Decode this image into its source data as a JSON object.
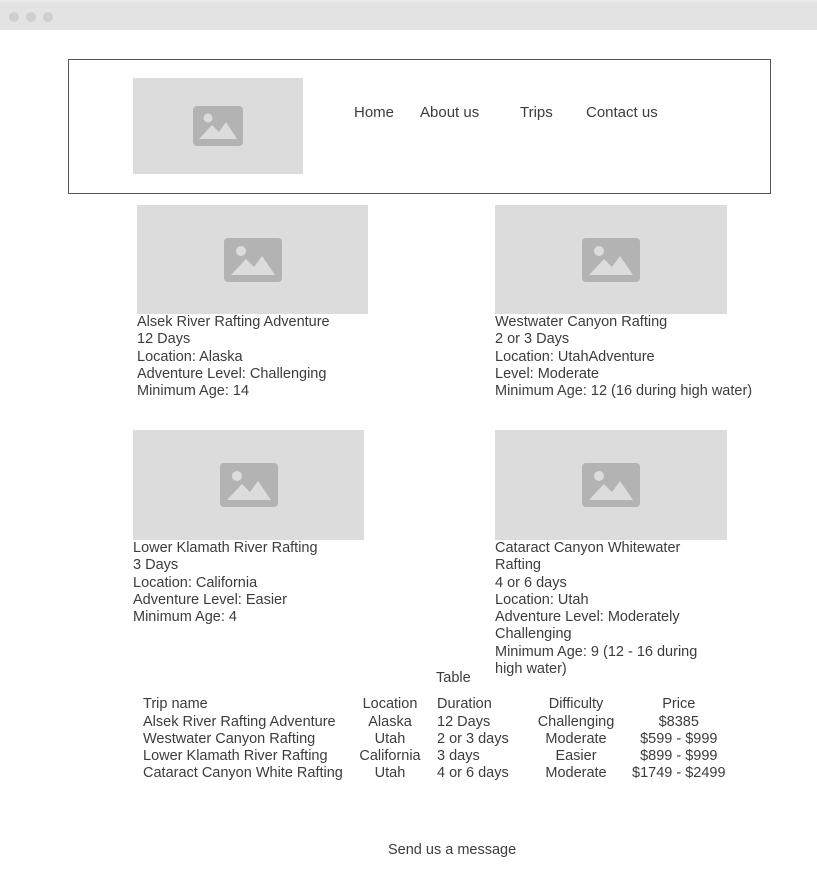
{
  "nav": {
    "items": [
      {
        "label": "Home"
      },
      {
        "label": "About us"
      },
      {
        "label": "Trips"
      },
      {
        "label": "Contact us"
      }
    ]
  },
  "cards": [
    {
      "title": "Alsek River Rafting Adventure",
      "duration": "12 Days",
      "location": "Location: Alaska",
      "level": "Adventure Level: Challenging",
      "age": "Minimum Age: 14"
    },
    {
      "title": "Westwater Canyon Rafting",
      "duration": "2 or 3 Days",
      "location": "Location: UtahAdventure",
      "level": "Level: Moderate",
      "age": "Minimum Age: 12 (16 during high water)"
    },
    {
      "title": "Lower Klamath River Rafting",
      "duration": "3 Days",
      "location": "Location: California",
      "level": "Adventure Level: Easier",
      "age": "Minimum Age: 4"
    },
    {
      "title": "Cataract Canyon Whitewater Rafting",
      "duration": "4 or 6 days",
      "location": "Location: Utah",
      "level": "Adventure Level: Moderately Challenging",
      "age": "Minimum Age: 9 (12 - 16 during high water)"
    }
  ],
  "table": {
    "title": "Table",
    "headers": [
      "Trip name",
      "Location",
      "Duration",
      "Difficulty",
      "Price"
    ],
    "rows": [
      [
        "Alsek River Rafting Adventure",
        "Alaska",
        "12 Days",
        "Challenging",
        "$8385"
      ],
      [
        "Westwater Canyon Rafting",
        "Utah",
        "2 or 3 days",
        "Moderate",
        "$599 - $999"
      ],
      [
        "Lower Klamath River Rafting",
        "California",
        "3 days",
        "Easier",
        "$899 - $999"
      ],
      [
        "Cataract Canyon White Rafting",
        "Utah",
        "4 or 6 days",
        "Moderate",
        "$1749 - $2499"
      ]
    ]
  },
  "footer": {
    "message_label": "Send us a message"
  },
  "colors": {
    "placeholder_bg": "#dcdcdc",
    "placeholder_icon": "#b3b3b3",
    "text": "#3c3c3c",
    "border": "#555555"
  },
  "icons": {
    "placeholder": "image-placeholder-icon",
    "window_controls": "window-dot-icon"
  }
}
